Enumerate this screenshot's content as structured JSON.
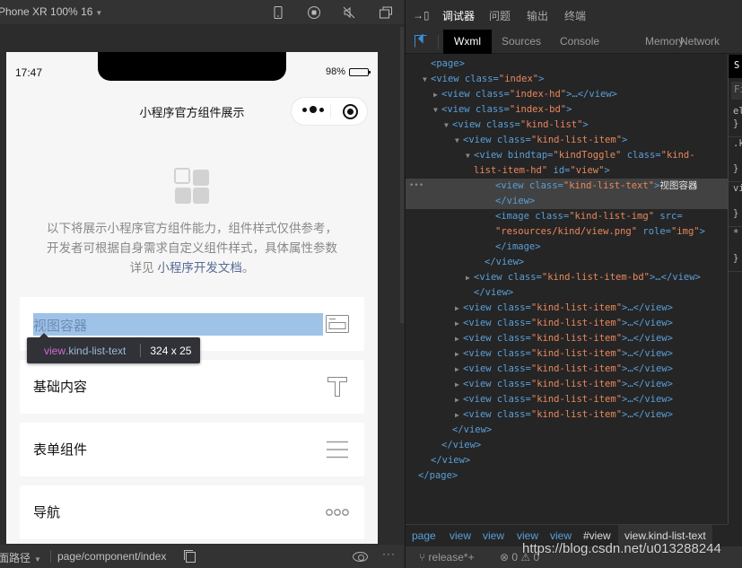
{
  "simulator": {
    "device_label": "Phone XR 100% 16",
    "toolbar_icons": [
      "phone-icon",
      "record-stop-icon",
      "mute-icon",
      "window-icon"
    ],
    "status_bar": {
      "time": "17:47",
      "battery": "98%",
      "battery_level": 0.98
    },
    "nav_title": "小程序官方组件展示",
    "intro": {
      "text": "以下将展示小程序官方组件能力，组件样式仅供参考，开发者可根据自身需求自定义组件样式，具体属性参数详见 ",
      "link": "小程序开发文档",
      "suffix": "。"
    },
    "kind_list": [
      {
        "label": "视图容器",
        "icon": "view-container-icon"
      },
      {
        "label": "基础内容",
        "icon": "text-t-icon"
      },
      {
        "label": "表单组件",
        "icon": "form-lines-icon"
      },
      {
        "label": "导航",
        "icon": "navigation-dots-icon"
      }
    ],
    "inspect_tooltip": {
      "tag": "view",
      "class": ".kind-list-text",
      "size": "324 x 25"
    },
    "bottom_bar": {
      "path_label": "面路径",
      "path": "page/component/index"
    }
  },
  "devtools": {
    "top_tabs": [
      {
        "label": "调试器",
        "active": true
      },
      {
        "label": "问题",
        "active": false
      },
      {
        "label": "输出",
        "active": false
      },
      {
        "label": "终端",
        "active": false
      }
    ],
    "panel_tabs": [
      {
        "label": "Wxml",
        "active": true
      },
      {
        "label": "Sources",
        "active": false
      },
      {
        "label": "Console",
        "active": false
      },
      {
        "label": "Memory",
        "active": false
      },
      {
        "label": "Network",
        "active": false
      }
    ],
    "wxml_tree": [
      {
        "indent": 0,
        "toggle": "",
        "tag": "<page>",
        "attrs": []
      },
      {
        "indent": 0,
        "toggle": "open",
        "tag": "<view",
        "attrs": [
          [
            "class",
            "index"
          ]
        ],
        "close": ">"
      },
      {
        "indent": 1,
        "toggle": "closed",
        "tag": "<view",
        "attrs": [
          [
            "class",
            "index-hd"
          ]
        ],
        "close": ">…</view>"
      },
      {
        "indent": 1,
        "toggle": "open",
        "tag": "<view",
        "attrs": [
          [
            "class",
            "index-bd"
          ]
        ],
        "close": ">"
      },
      {
        "indent": 2,
        "toggle": "open",
        "tag": "<view",
        "attrs": [
          [
            "class",
            "kind-list"
          ]
        ],
        "close": ">"
      },
      {
        "indent": 3,
        "toggle": "open",
        "tag": "<view",
        "attrs": [
          [
            "class",
            "kind-list-item"
          ]
        ],
        "close": ">"
      },
      {
        "indent": 4,
        "toggle": "open",
        "tag": "<view",
        "attrs": [
          [
            "bindtap",
            "kindToggle"
          ],
          [
            "class",
            "kind-"
          ]
        ],
        "close": ""
      },
      {
        "indent": 4,
        "cont": true,
        "raw_val": "list-item-hd\"",
        "attrs": [
          [
            "id",
            "view"
          ]
        ],
        "close": ">"
      },
      {
        "indent": 6,
        "toggle": "",
        "tag": "<view",
        "attrs": [
          [
            "class",
            "kind-list-text"
          ]
        ],
        "close": ">",
        "text": "视图容器",
        "selected": true
      },
      {
        "indent": 6,
        "toggle": "",
        "tag": "</view>",
        "attrs": [],
        "selected": true
      },
      {
        "indent": 6,
        "toggle": "",
        "tag": "<image",
        "attrs": [
          [
            "class",
            "kind-list-img"
          ]
        ],
        "close": " src="
      },
      {
        "indent": 6,
        "cont": true,
        "raw_val": "\"resources/kind/view.png\"",
        "attrs": [
          [
            "role",
            "img"
          ]
        ],
        "close": ">"
      },
      {
        "indent": 6,
        "toggle": "",
        "tag": "</image>",
        "attrs": []
      },
      {
        "indent": 5,
        "toggle": "",
        "tag": "</view>",
        "attrs": []
      },
      {
        "indent": 4,
        "toggle": "closed",
        "tag": "<view",
        "attrs": [
          [
            "class",
            "kind-list-item-bd"
          ]
        ],
        "close": ">…</view>"
      },
      {
        "indent": 4,
        "toggle": "",
        "tag": "</view>",
        "attrs": []
      },
      {
        "indent": 3,
        "toggle": "closed",
        "tag": "<view",
        "attrs": [
          [
            "class",
            "kind-list-item"
          ]
        ],
        "close": ">…</view>"
      },
      {
        "indent": 3,
        "toggle": "closed",
        "tag": "<view",
        "attrs": [
          [
            "class",
            "kind-list-item"
          ]
        ],
        "close": ">…</view>"
      },
      {
        "indent": 3,
        "toggle": "closed",
        "tag": "<view",
        "attrs": [
          [
            "class",
            "kind-list-item"
          ]
        ],
        "close": ">…</view>"
      },
      {
        "indent": 3,
        "toggle": "closed",
        "tag": "<view",
        "attrs": [
          [
            "class",
            "kind-list-item"
          ]
        ],
        "close": ">…</view>"
      },
      {
        "indent": 3,
        "toggle": "closed",
        "tag": "<view",
        "attrs": [
          [
            "class",
            "kind-list-item"
          ]
        ],
        "close": ">…</view>"
      },
      {
        "indent": 3,
        "toggle": "closed",
        "tag": "<view",
        "attrs": [
          [
            "class",
            "kind-list-item"
          ]
        ],
        "close": ">…</view>"
      },
      {
        "indent": 3,
        "toggle": "closed",
        "tag": "<view",
        "attrs": [
          [
            "class",
            "kind-list-item"
          ]
        ],
        "close": ">…</view>"
      },
      {
        "indent": 3,
        "toggle": "closed",
        "tag": "<view",
        "attrs": [
          [
            "class",
            "kind-list-item"
          ]
        ],
        "close": ">…</view>"
      },
      {
        "indent": 2,
        "toggle": "",
        "tag": "</view>",
        "attrs": []
      },
      {
        "indent": 1,
        "toggle": "",
        "tag": "</view>",
        "attrs": []
      },
      {
        "indent": 0,
        "toggle": "",
        "tag": "</view>",
        "attrs": []
      },
      {
        "indent": -1,
        "toggle": "",
        "tag": "</page>",
        "attrs": []
      }
    ],
    "styles_pane": {
      "tab": "S",
      "filter": "Fi",
      "rules": [
        "el\n}",
        ".k\n\n}",
        "vi\n\n}",
        "*\n\n}"
      ]
    },
    "breadcrumbs": [
      "page",
      "view",
      "view",
      "view",
      "view",
      "#view",
      "view.kind-list-text"
    ],
    "status": {
      "branch": "release*+",
      "errors": "0",
      "warnings": "0"
    }
  },
  "watermark": "https://blog.csdn.net/u013288244",
  "colors": {
    "highlight": "#9fc3e7",
    "tag": "#5a9fd6",
    "attr_value": "#e8885a",
    "link": "#576b95",
    "tooltip_tag": "#cf6bd2"
  }
}
